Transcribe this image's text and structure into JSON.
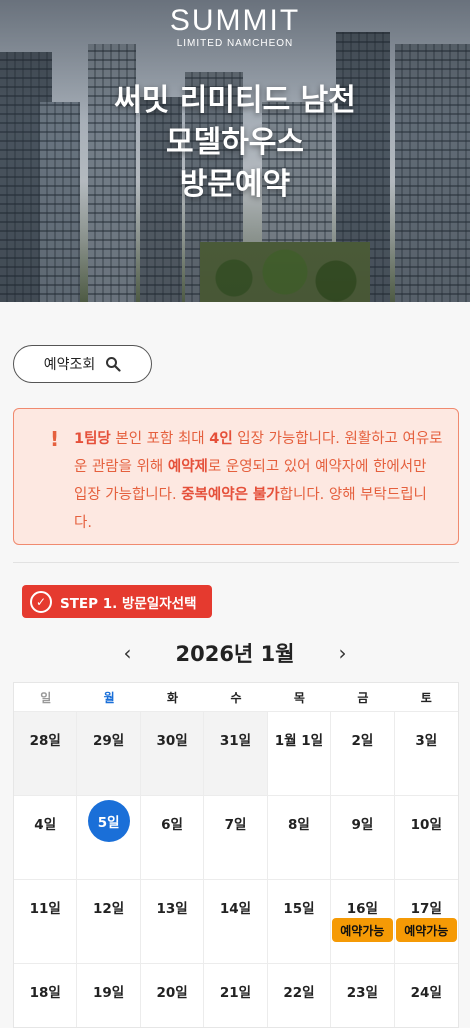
{
  "hero": {
    "brand": "SUMMIT",
    "brand_sub": "LIMITED NAMCHEON",
    "title_lines": [
      "써밋 리미티드 남천",
      "모델하우스",
      "방문예약"
    ]
  },
  "search": {
    "label": "예약조회",
    "icon": "search-icon"
  },
  "notice": {
    "icon": "exclamation-icon",
    "segments": [
      {
        "t": "1팀당",
        "b": true
      },
      {
        "t": " 본인 포함 최대 ",
        "b": false
      },
      {
        "t": "4인",
        "b": true
      },
      {
        "t": " 입장 가능합니다. 원활하고 여유로운 관람을 위해 ",
        "b": false
      },
      {
        "t": "예약제",
        "b": true
      },
      {
        "t": "로 운영되고 있어 예약자에 한에서만 입장 가능합니다. ",
        "b": false
      },
      {
        "t": "중복예약은 불가",
        "b": true
      },
      {
        "t": "합니다. 양해 부탁드립니다.",
        "b": false
      }
    ],
    "color": "#e5603e"
  },
  "step": {
    "label": "STEP 1. 방문일자선택",
    "color": "#e53a2f"
  },
  "calendar": {
    "title": "2026년 1월",
    "prev_icon": "chevron-left-icon",
    "next_icon": "chevron-right-icon",
    "weekdays": [
      "일",
      "월",
      "화",
      "수",
      "목",
      "금",
      "토"
    ],
    "weeks": [
      [
        {
          "d": "28일",
          "muted": true
        },
        {
          "d": "29일",
          "muted": true
        },
        {
          "d": "30일",
          "muted": true
        },
        {
          "d": "31일",
          "muted": true
        },
        {
          "d": "1월 1일"
        },
        {
          "d": "2일"
        },
        {
          "d": "3일"
        }
      ],
      [
        {
          "d": "4일"
        },
        {
          "d": "5일",
          "selected": true
        },
        {
          "d": "6일"
        },
        {
          "d": "7일"
        },
        {
          "d": "8일"
        },
        {
          "d": "9일"
        },
        {
          "d": "10일"
        }
      ],
      [
        {
          "d": "11일"
        },
        {
          "d": "12일"
        },
        {
          "d": "13일"
        },
        {
          "d": "14일"
        },
        {
          "d": "15일"
        },
        {
          "d": "16일",
          "badge": "예약가능"
        },
        {
          "d": "17일",
          "badge": "예약가능"
        }
      ],
      [
        {
          "d": "18일"
        },
        {
          "d": "19일"
        },
        {
          "d": "20일"
        },
        {
          "d": "21일"
        },
        {
          "d": "22일"
        },
        {
          "d": "23일"
        },
        {
          "d": "24일"
        }
      ]
    ],
    "selected_color": "#1a6fd8",
    "badge_color": "#f59a05"
  }
}
